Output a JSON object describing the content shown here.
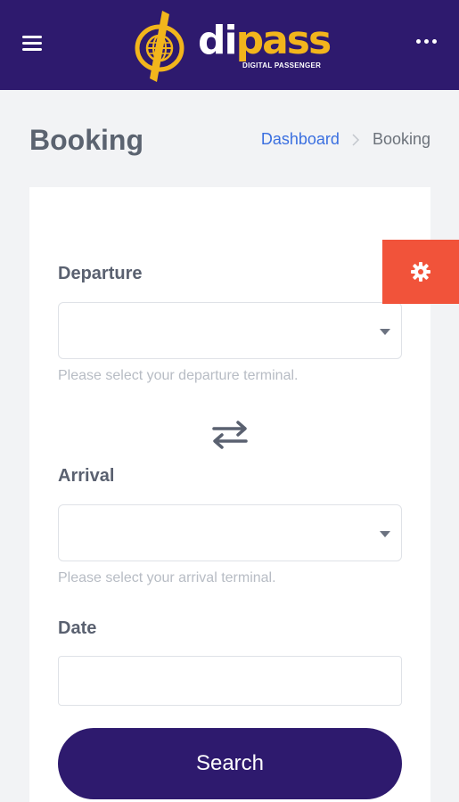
{
  "header": {
    "brand_di": "di",
    "brand_pass": "pass",
    "brand_tagline": "DIGITAL PASSENGER",
    "menu_icon": "hamburger-icon",
    "more_icon": "ellipsis-icon",
    "background_color": "#2e1a6e",
    "accent_color": "#f2b51c"
  },
  "page": {
    "title": "Booking",
    "breadcrumb": {
      "link": "Dashboard",
      "current": "Booking",
      "separator_icon": "chevron-right-icon"
    }
  },
  "form": {
    "departure": {
      "label": "Departure",
      "value": "",
      "help": "Please select your departure terminal."
    },
    "swap_icon": "swap-arrows-icon",
    "arrival": {
      "label": "Arrival",
      "value": "",
      "help": "Please select your arrival terminal."
    },
    "date": {
      "label": "Date",
      "value": ""
    },
    "search_label": "Search"
  },
  "settings_tab": {
    "icon": "gear-icon",
    "color": "#f1533a"
  }
}
